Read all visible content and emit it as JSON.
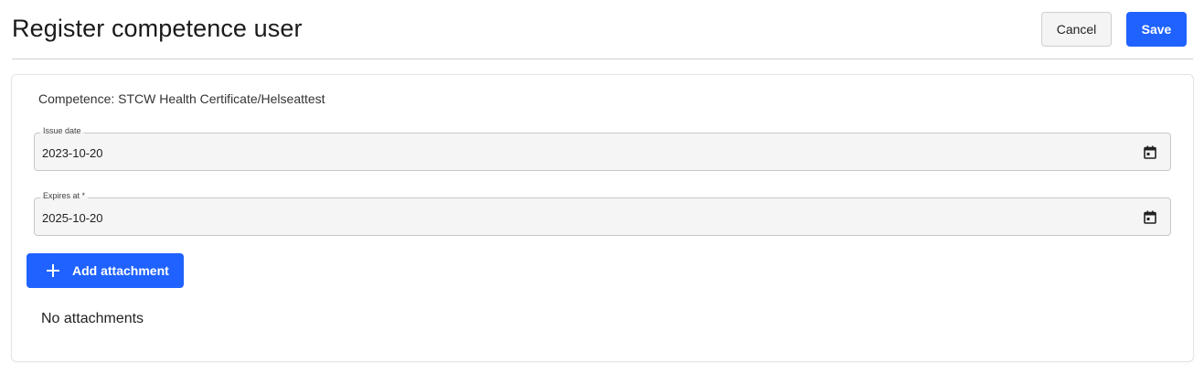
{
  "header": {
    "title": "Register competence user",
    "cancel_label": "Cancel",
    "save_label": "Save"
  },
  "form": {
    "competence_text": "Competence: STCW Health Certificate/Helseattest",
    "issue_date": {
      "label": "Issue date",
      "value": "2023-10-20",
      "icon": "calendar-icon"
    },
    "expires_at": {
      "label": "Expires at *",
      "value": "2025-10-20",
      "icon": "calendar-icon"
    },
    "add_attachment_label": "Add attachment",
    "add_attachment_icon": "plus-icon",
    "no_attachments_text": "No attachments"
  },
  "colors": {
    "primary": "#1f62ff",
    "field_bg": "#f5f5f5",
    "cancel_bg": "#f4f4f4"
  }
}
